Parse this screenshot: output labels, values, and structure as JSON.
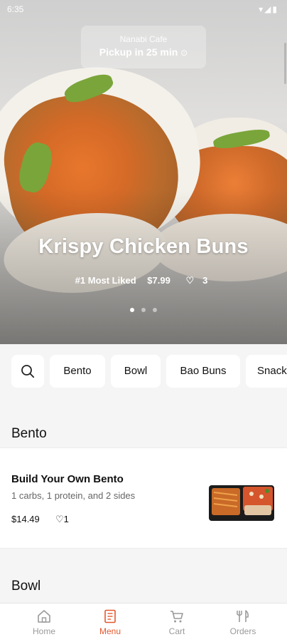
{
  "status_bar": {
    "time": "6:35",
    "icons": "▾◢▮"
  },
  "hero": {
    "cafe_name": "Nanabi Cafe",
    "pickup_text": "Pickup in 25 min",
    "pickup_icon": "clock-icon",
    "title": "Krispy Chicken Buns",
    "badge": "#1 Most Liked",
    "price": "$7.99",
    "likes": "3",
    "slides": 3,
    "active_slide": 1
  },
  "categories": {
    "search_icon": "search-icon",
    "items": [
      "Bento",
      "Bowl",
      "Bao Buns",
      "Snack"
    ]
  },
  "sections": [
    {
      "title": "Bento",
      "items": [
        {
          "name": "Build Your Own Bento",
          "description": "1 carbs, 1 protein, and 2 sides",
          "price": "$14.49",
          "likes": "1"
        }
      ]
    },
    {
      "title": "Bowl"
    }
  ],
  "bottom_nav": {
    "items": [
      "Home",
      "Menu",
      "Cart",
      "Orders"
    ],
    "active": "Menu",
    "active_color": "#e4572e",
    "inactive_color": "#9a9a9a"
  }
}
